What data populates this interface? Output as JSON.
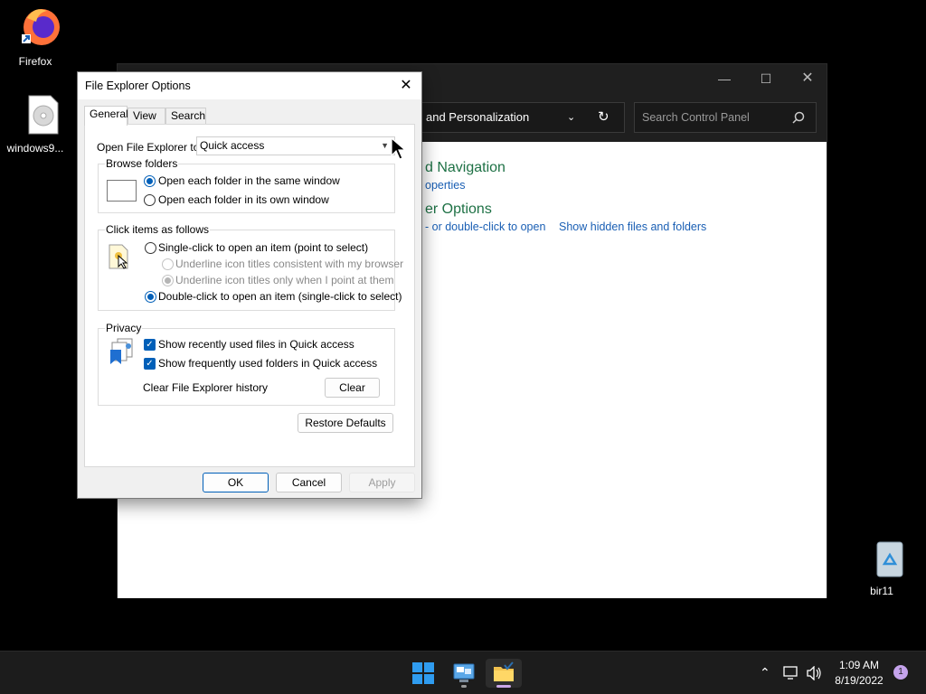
{
  "desktop": {
    "firefox_label": "Firefox",
    "file_label": "windows9...",
    "recycle_label": "bir11"
  },
  "control_panel": {
    "breadcrumb": "and Personalization",
    "search_placeholder": "Search Control Panel",
    "heading1": "d Navigation",
    "link1": "operties",
    "heading2": "er Options",
    "link2": "- or double-click to open",
    "link3": "Show hidden files and folders"
  },
  "dialog": {
    "title": "File Explorer Options",
    "tabs": [
      "General",
      "View",
      "Search"
    ],
    "open_label": "Open File Explorer to:",
    "open_value": "Quick access",
    "browse": {
      "title": "Browse folders",
      "opt1": "Open each folder in the same window",
      "opt2": "Open each folder in its own window"
    },
    "click": {
      "title": "Click items as follows",
      "opt1": "Single-click to open an item (point to select)",
      "sub1": "Underline icon titles consistent with my browser",
      "sub2": "Underline icon titles only when I point at them",
      "opt2": "Double-click to open an item (single-click to select)"
    },
    "privacy": {
      "title": "Privacy",
      "chk1": "Show recently used files in Quick access",
      "chk2": "Show frequently used folders in Quick access",
      "clear_label": "Clear File Explorer history",
      "clear_button": "Clear"
    },
    "restore_button": "Restore Defaults",
    "ok": "OK",
    "cancel": "Cancel",
    "apply": "Apply"
  },
  "taskbar": {
    "time": "1:09 AM",
    "date": "8/19/2022",
    "notification_count": "1"
  },
  "colors": {
    "accent": "#005fb8",
    "cp_heading": "#1e7145",
    "cp_link": "#1a5fb4"
  }
}
